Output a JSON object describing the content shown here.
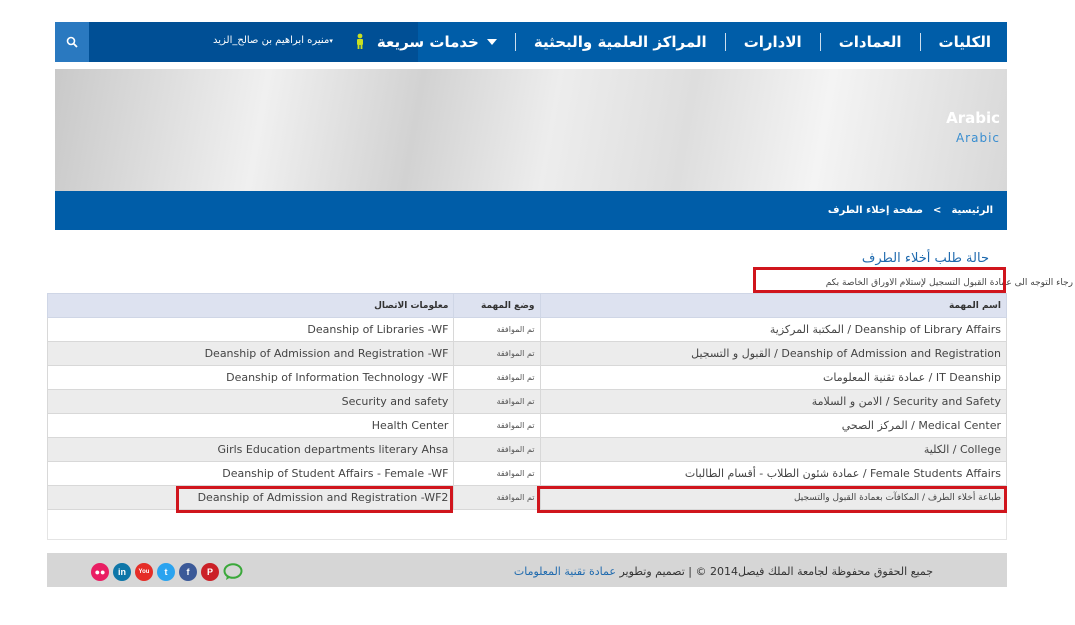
{
  "nav": {
    "menu": [
      "الكليات",
      "العمادات",
      "الادارات",
      "المراكز العلمية والبحثية",
      "خدمات سريعة"
    ],
    "user_name": "منيره ابراهيم بن صالح_الزيد",
    "icons": [
      "search-icon",
      "user-icon",
      "chevron-down-icon"
    ]
  },
  "banner": {
    "title": "Arabic",
    "subtitle": "Arabic"
  },
  "breadcrumb": {
    "home": "الرئيسية",
    "separator": ">",
    "current": "صفحة إخلاء الطرف"
  },
  "page": {
    "title": "حالة طلب أخلاء الطرف",
    "notice": "رجاء التوجه الى عمادة القبول التسجيل لإستلام الأوراق الخاصة بكم"
  },
  "table": {
    "headers": {
      "task": "اسم المهمة",
      "status": "وضع المهمة",
      "contact": "معلومات الاتصال"
    },
    "rows": [
      {
        "task": "Deanship of Library Affairs / المكتبة المركزية",
        "status": "تم الموافقة",
        "contact": "Deanship of Libraries -WF"
      },
      {
        "task": "Deanship of Admission and Registration / القبول و التسجيل",
        "status": "تم الموافقة",
        "contact": "Deanship of Admission and Registration -WF"
      },
      {
        "task": "IT Deanship / عمادة تقنية المعلومات",
        "status": "تم الموافقة",
        "contact": "Deanship of Information Technology -WF"
      },
      {
        "task": "Security and Safety / الامن و السلامة",
        "status": "تم الموافقة",
        "contact": "Security and safety"
      },
      {
        "task": "Medical Center / المركز الصحي",
        "status": "تم الموافقة",
        "contact": "Health Center"
      },
      {
        "task": "College / الكلية",
        "status": "تم الموافقة",
        "contact": "Girls Education departments literary Ahsa"
      },
      {
        "task": "Female Students Affairs / عمادة شئون الطلاب - أقسام الطالبات",
        "status": "تم الموافقة",
        "contact": "Deanship of Student Affairs - Female -WF"
      },
      {
        "task": "طباعة أخلاء الطرف / المكافآت بعمادة القبول والتسجيل",
        "status": "تم الموافقة",
        "contact": "Deanship of Admission and Registration -WF2"
      }
    ]
  },
  "footer": {
    "copyright": "جميع الحقوق محفوظة لجامعة الملك فيصل2014 © | تصميم وتطوير",
    "link": "عمادة تقنية المعلومات",
    "social": [
      {
        "icon": "comment-icon",
        "label": "",
        "color": "#ffffff"
      },
      {
        "icon": "pinterest-icon",
        "label": "P",
        "color": "#cb2027"
      },
      {
        "icon": "facebook-icon",
        "label": "f",
        "color": "#3b5998"
      },
      {
        "icon": "twitter-icon",
        "label": "t",
        "color": "#2aa3ef"
      },
      {
        "icon": "youtube-icon",
        "label": "You",
        "color": "#e52d27"
      },
      {
        "icon": "linkedin-icon",
        "label": "in",
        "color": "#0e76a8"
      },
      {
        "icon": "flickr-icon",
        "label": "●●",
        "color": "#e91e63"
      }
    ]
  },
  "colors": {
    "primary": "#005da8",
    "highlight": "#d0151d",
    "table_header": "#dde2f0"
  }
}
